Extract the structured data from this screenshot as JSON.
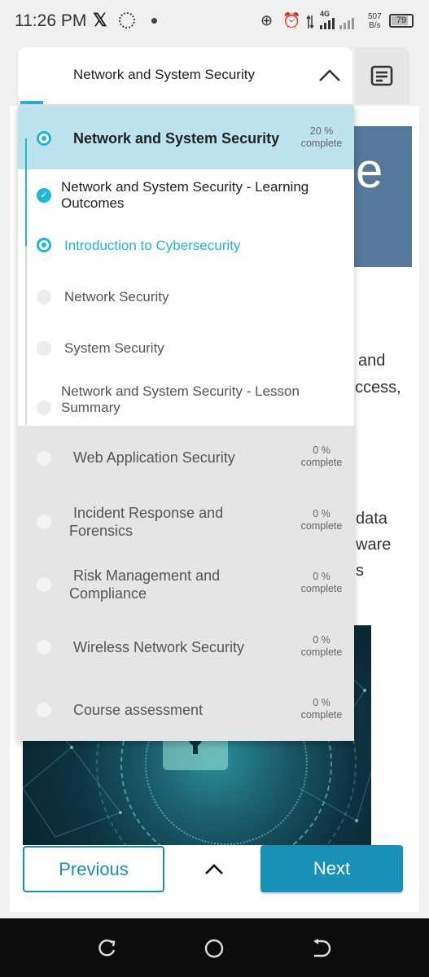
{
  "status_bar": {
    "time": "11:26 PM",
    "network_type": "4G",
    "net_speed_value": "507",
    "net_speed_unit": "B/s",
    "battery": "79"
  },
  "header": {
    "course_title": "Network and System Security"
  },
  "background": {
    "hero_letter": "e",
    "text_fragments": [
      "and",
      "ccess,",
      "data",
      "ware",
      "s"
    ]
  },
  "outline": {
    "active_module": {
      "title": "Network and System Security",
      "progress": "20 %",
      "progress_label": "complete"
    },
    "lessons": [
      {
        "title": "Network and System Security - Learning Outcomes",
        "status": "completed"
      },
      {
        "title": "Introduction to Cybersecurity",
        "status": "current"
      },
      {
        "title": "Network Security",
        "status": "not-started"
      },
      {
        "title": "System Security",
        "status": "not-started"
      },
      {
        "title": "Network and System Security - Lesson Summary",
        "status": "not-started"
      }
    ],
    "modules": [
      {
        "title": "Web Application Security",
        "progress": "0 %",
        "progress_label": "complete"
      },
      {
        "title": "Incident Response and Forensics",
        "progress": "0 %",
        "progress_label": "complete"
      },
      {
        "title": "Risk Management and Compliance",
        "progress": "0 %",
        "progress_label": "complete"
      },
      {
        "title": "Wireless Network Security",
        "progress": "0 %",
        "progress_label": "complete"
      },
      {
        "title": "Course assessment",
        "progress": "0 %",
        "progress_label": "complete"
      }
    ]
  },
  "nav": {
    "previous": "Previous",
    "next": "Next"
  },
  "colors": {
    "accent": "#21b5d8",
    "primary_button": "#1890b8",
    "active_module_bg": "#bde3ee",
    "hero_band": "#56799b"
  },
  "icons": {
    "chevron": "chevron-up-icon",
    "outline": "outline-list-icon",
    "nav_recent": "recent-apps-icon",
    "nav_home": "home-icon",
    "nav_back": "back-icon"
  }
}
